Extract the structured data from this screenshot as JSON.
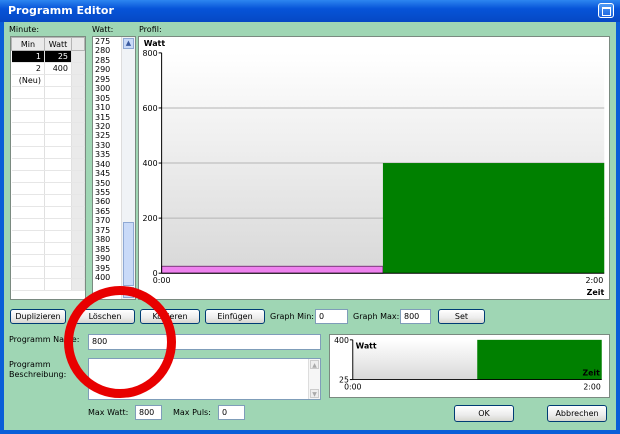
{
  "window": {
    "title": "Programm Editor"
  },
  "labels": {
    "minute": "Minute:",
    "watt": "Watt:",
    "profil": "Profil:",
    "graph_min": "Graph Min:",
    "graph_max": "Graph Max:",
    "programm_name": "Programm Name:",
    "programm_beschreibung_1": "Programm",
    "programm_beschreibung_2": "Beschreibung:",
    "max_watt": "Max Watt:",
    "max_puls": "Max Puls:"
  },
  "minute_table": {
    "headers": [
      "Min",
      "Watt"
    ],
    "rows": [
      [
        "1",
        "25"
      ],
      [
        "2",
        "400"
      ],
      [
        "(Neu)",
        ""
      ]
    ]
  },
  "watt_list": [
    "275",
    "280",
    "285",
    "290",
    "295",
    "300",
    "305",
    "310",
    "315",
    "320",
    "325",
    "330",
    "335",
    "340",
    "345",
    "350",
    "355",
    "360",
    "365",
    "370",
    "375",
    "380",
    "385",
    "390",
    "395",
    "400"
  ],
  "buttons": {
    "duplizieren": "Duplizieren",
    "loeschen": "Löschen",
    "kopieren": "Kopieren",
    "einfuegen": "Einfügen",
    "set": "Set",
    "ok": "OK",
    "abbrechen": "Abbrechen"
  },
  "inputs": {
    "graph_min": "0",
    "graph_max": "800",
    "programm_name": "800",
    "programm_beschreibung": "",
    "max_watt": "800",
    "max_puls": "0"
  },
  "colors": {
    "bar_green": "#008000",
    "bar_pink": "#ee82ee",
    "highlight_ring": "#e80000"
  },
  "chart_data": [
    {
      "type": "area",
      "ylabel": "Watt",
      "xlabel": "Zeit",
      "ylim": [
        0,
        800
      ],
      "yticks": [
        0,
        200,
        400,
        600,
        800
      ],
      "x_tick_labels": [
        "0:00",
        "2:00"
      ],
      "segments": [
        {
          "minute_start": 0,
          "minute_end": 1,
          "watt": 25,
          "color": "#ee82ee"
        },
        {
          "minute_start": 1,
          "minute_end": 2,
          "watt": 400,
          "color": "#008000"
        }
      ],
      "xlim": [
        0,
        2
      ],
      "grid": true
    },
    {
      "type": "area",
      "ylabel": "Watt",
      "xlabel": "Zeit",
      "ylim": [
        25,
        400
      ],
      "yticks": [
        25,
        400
      ],
      "x_tick_labels": [
        "0:00",
        "2:00"
      ],
      "segments": [
        {
          "minute_start": 0,
          "minute_end": 1,
          "watt": 25,
          "color": "#008000"
        },
        {
          "minute_start": 1,
          "minute_end": 2,
          "watt": 400,
          "color": "#008000"
        }
      ],
      "xlim": [
        0,
        2
      ],
      "grid": false
    }
  ]
}
